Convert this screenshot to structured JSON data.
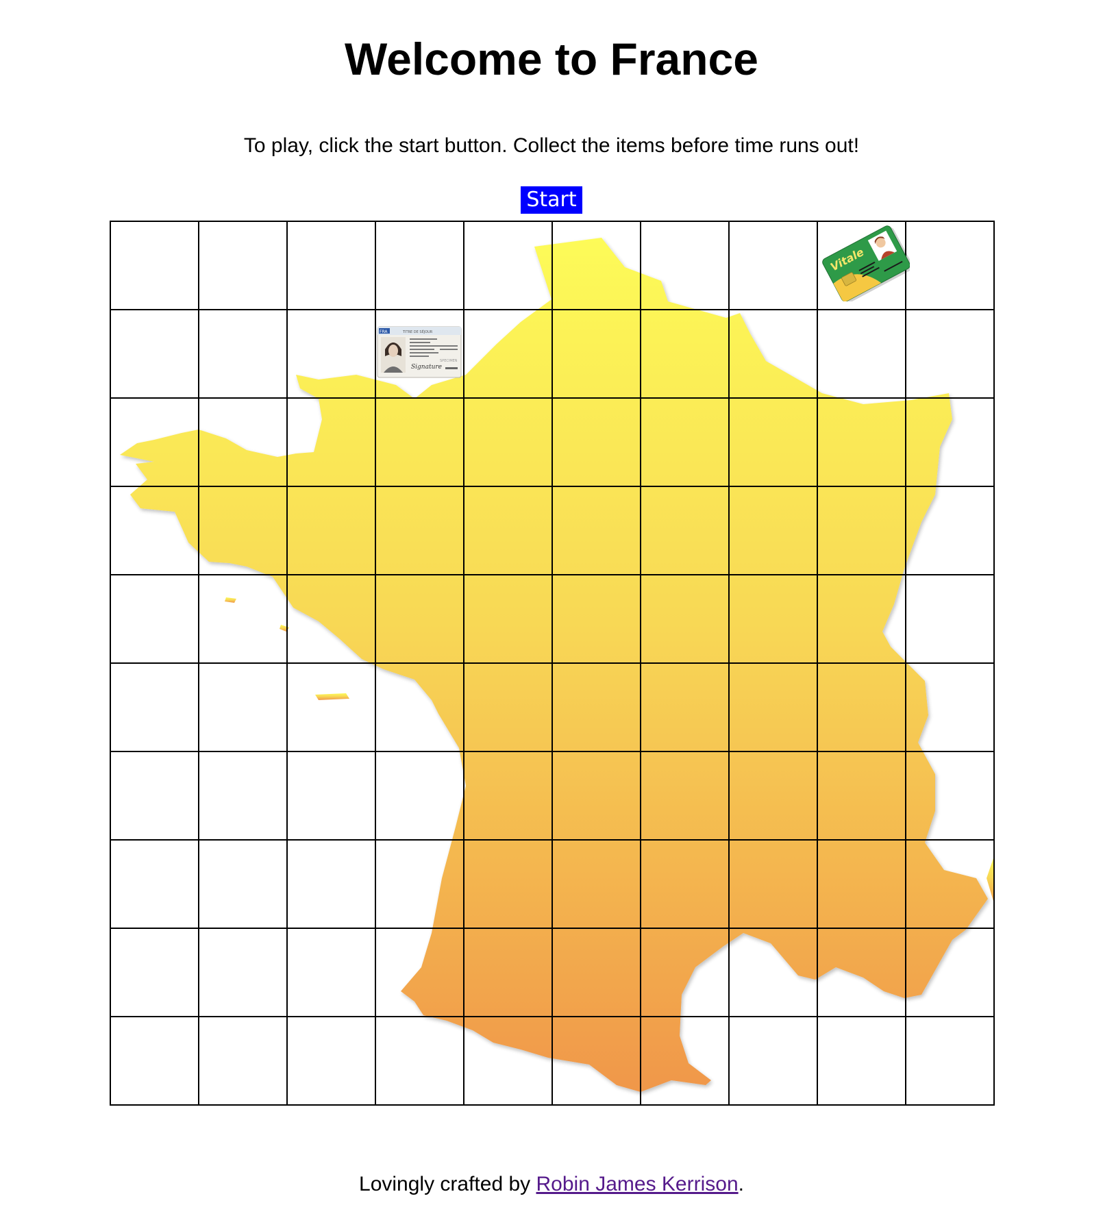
{
  "header": {
    "title": "Welcome to France",
    "instructions": "To play, click the start button. Collect the items before time runs out!"
  },
  "controls": {
    "start_label": "Start"
  },
  "board": {
    "rows": 10,
    "columns": 10,
    "background": "france-map",
    "map_gradient_top": "#fdfb58",
    "map_gradient_bottom": "#f0974a",
    "items": [
      {
        "name": "titre-de-sejour-card",
        "row": 2,
        "column": 4,
        "card_header": "TITRE DE SÉJOUR",
        "card_country": "FRA",
        "card_specimen": "SPECIMEN",
        "card_signature": "Signature"
      },
      {
        "name": "carte-vitale-card",
        "row": 1,
        "column": 9,
        "card_label": "Vitale",
        "card_color": "#2e9a48"
      }
    ]
  },
  "footer": {
    "prefix": "Lovingly crafted by ",
    "author_link": "Robin James Kerrison",
    "suffix": "."
  }
}
